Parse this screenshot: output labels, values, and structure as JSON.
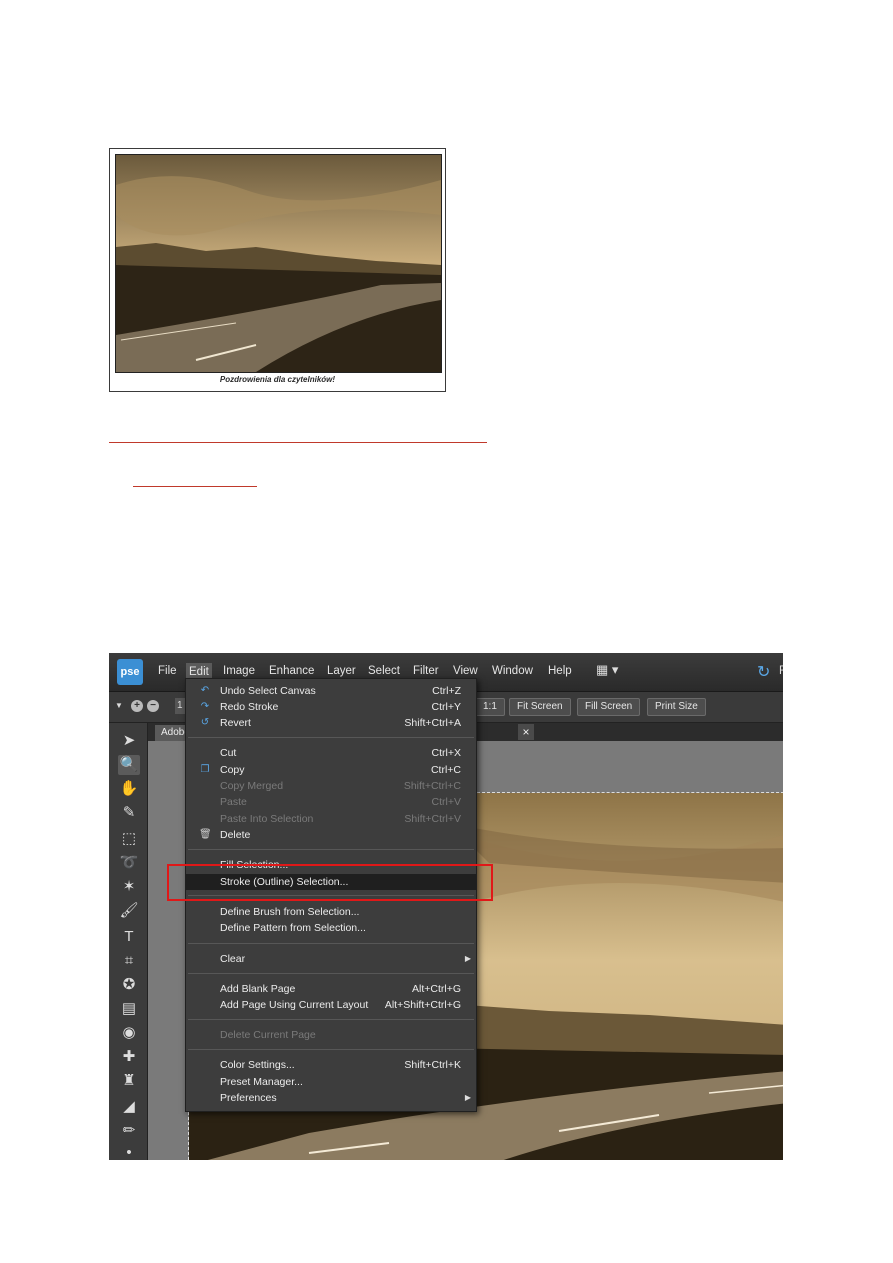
{
  "photo_card": {
    "caption": "Pozdrowienia dla czytelników!"
  },
  "pse": {
    "logo": "pse",
    "menu": [
      "File",
      "Edit",
      "Image",
      "Enhance",
      "Layer",
      "Select",
      "Filter",
      "View",
      "Window",
      "Help"
    ],
    "active_menu": "Edit",
    "right_letter": "F",
    "options": {
      "zoom_value": "1",
      "buttons": [
        "1:1",
        "Fit Screen",
        "Fill Screen",
        "Print Size"
      ]
    },
    "doc_tab": "Adobe",
    "close_glyph": "×",
    "edit_menu": [
      {
        "label": "Undo Select Canvas",
        "shortcut": "Ctrl+Z",
        "enabled": true,
        "icon": "undo-icon"
      },
      {
        "label": "Redo Stroke",
        "shortcut": "Ctrl+Y",
        "enabled": true,
        "icon": "redo-icon"
      },
      {
        "label": "Revert",
        "shortcut": "Shift+Ctrl+A",
        "enabled": true,
        "icon": "revert-icon"
      },
      {
        "label": "Cut",
        "shortcut": "Ctrl+X",
        "enabled": true
      },
      {
        "label": "Copy",
        "shortcut": "Ctrl+C",
        "enabled": true,
        "icon": "copy-icon"
      },
      {
        "label": "Copy Merged",
        "shortcut": "Shift+Ctrl+C",
        "enabled": false
      },
      {
        "label": "Paste",
        "shortcut": "Ctrl+V",
        "enabled": false
      },
      {
        "label": "Paste Into Selection",
        "shortcut": "Shift+Ctrl+V",
        "enabled": false
      },
      {
        "label": "Delete",
        "shortcut": "",
        "enabled": true,
        "icon": "trash-icon"
      },
      {
        "label": "Fill Selection...",
        "shortcut": "",
        "enabled": true
      },
      {
        "label": "Stroke (Outline) Selection...",
        "shortcut": "",
        "enabled": true,
        "highlighted": true
      },
      {
        "label": "Define Brush from Selection...",
        "shortcut": "",
        "enabled": true
      },
      {
        "label": "Define Pattern from Selection...",
        "shortcut": "",
        "enabled": true
      },
      {
        "label": "Clear",
        "shortcut": "",
        "enabled": true,
        "submenu": true
      },
      {
        "label": "Add Blank Page",
        "shortcut": "Alt+Ctrl+G",
        "enabled": true
      },
      {
        "label": "Add Page Using Current Layout",
        "shortcut": "Alt+Shift+Ctrl+G",
        "enabled": true
      },
      {
        "label": "Delete Current Page",
        "shortcut": "",
        "enabled": false
      },
      {
        "label": "Color Settings...",
        "shortcut": "Shift+Ctrl+K",
        "enabled": true
      },
      {
        "label": "Preset Manager...",
        "shortcut": "",
        "enabled": true
      },
      {
        "label": "Preferences",
        "shortcut": "",
        "enabled": true,
        "submenu": true
      }
    ]
  },
  "colors": {
    "highlight_border": "#e01818",
    "link_underline": "#c0392b",
    "sepia": "#b89a64"
  }
}
